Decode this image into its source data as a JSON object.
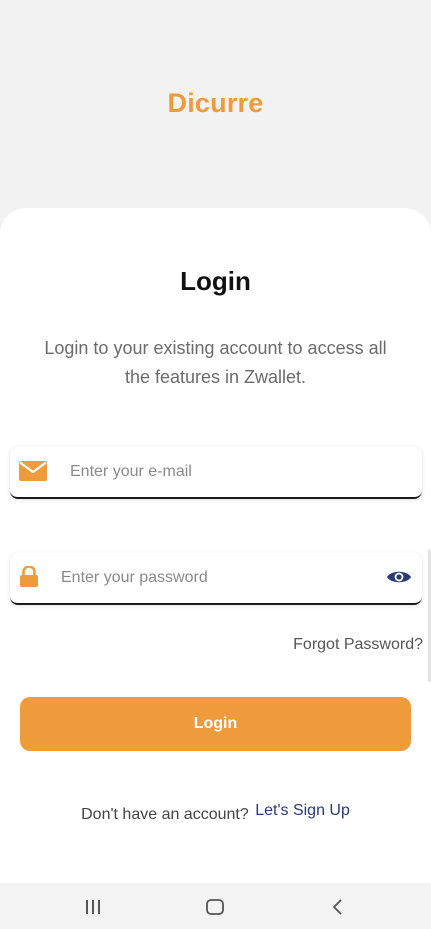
{
  "app": {
    "brand_name": "Dicurre",
    "accent_color": "#ef9b3c",
    "link_color": "#2a3b78"
  },
  "login": {
    "title": "Login",
    "subtitle": "Login to your existing account to access all the features in Zwallet.",
    "email": {
      "placeholder": "Enter your e-mail",
      "value": "",
      "icon": "envelope-icon"
    },
    "password": {
      "placeholder": "Enter your password",
      "value": "",
      "icon": "lock-icon",
      "toggle_icon": "eye-icon"
    },
    "forgot_label": "Forgot Password?",
    "submit_label": "Login",
    "signup_prompt": "Don't have an account?",
    "signup_link": "Let's Sign Up"
  },
  "navbar": {
    "recents_icon": "recents-icon",
    "home_icon": "home-icon",
    "back_icon": "back-icon"
  }
}
